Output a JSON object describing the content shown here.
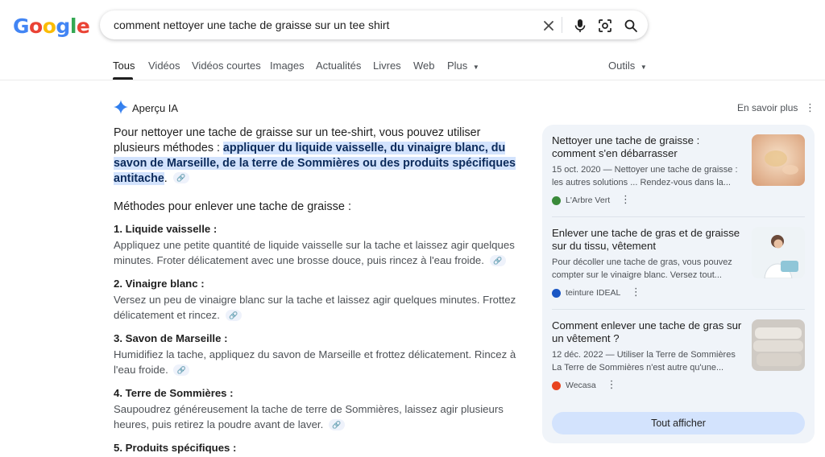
{
  "logo": {
    "letters": [
      "G",
      "o",
      "o",
      "g",
      "l",
      "e"
    ]
  },
  "search": {
    "query": "comment nettoyer une tache de graisse sur un tee shirt"
  },
  "search_icons": [
    "close-icon",
    "mic-icon",
    "lens-icon",
    "search-icon"
  ],
  "tabs": [
    {
      "label": "Tous",
      "active": true
    },
    {
      "label": "Vidéos"
    },
    {
      "label": "Vidéos courtes"
    },
    {
      "label": "Images"
    },
    {
      "label": "Actualités"
    },
    {
      "label": "Livres"
    },
    {
      "label": "Web"
    },
    {
      "label": "Plus"
    }
  ],
  "tools_label": "Outils",
  "ai": {
    "title": "Aperçu IA",
    "learn_more": "En savoir plus",
    "intro_plain": "Pour nettoyer une tache de graisse sur un tee-shirt, vous pouvez utiliser plusieurs méthodes : ",
    "intro_highlight": "appliquer du liquide vaisselle, du vinaigre blanc, du savon de Marseille, de la terre de Sommières ou des produits spécifiques antitache",
    "intro_end": ".",
    "methods_heading": "Méthodes pour enlever une tache de graisse :",
    "methods": [
      {
        "title": "1. Liquide vaisselle :",
        "text": "Appliquez une petite quantité de liquide vaisselle sur la tache et laissez agir quelques minutes. Froter délicatement avec une brosse douce, puis rincez à l'eau froide."
      },
      {
        "title": "2. Vinaigre blanc :",
        "text": "Versez un peu de vinaigre blanc sur la tache et laissez agir quelques minutes. Frottez délicatement et rincez."
      },
      {
        "title": "3. Savon de Marseille :",
        "text": "Humidifiez la tache, appliquez du savon de Marseille et frottez délicatement. Rincez à l'eau froide."
      },
      {
        "title": "4. Terre de Sommières :",
        "text": "Saupoudrez généreusement la tache de terre de Sommières, laissez agir plusieurs heures, puis retirez la poudre avant de laver."
      },
      {
        "title": "5. Produits spécifiques :",
        "text": ""
      }
    ]
  },
  "sources": [
    {
      "title": "Nettoyer une tache de graisse : comment s'en débarrasser",
      "snippet": "15 oct. 2020 — Nettoyer une tache de graisse : les autres solutions ... Rendez-vous dans la...",
      "site": "L'Arbre Vert",
      "favicon_color": "#3a8a3a"
    },
    {
      "title": "Enlever une tache de gras et de graisse sur du tissu, vêtement",
      "snippet": "Pour décoller une tache de gras, vous pouvez compter sur le vinaigre blanc. Versez tout...",
      "site": "teinture IDEAL",
      "favicon_color": "#1a56c4"
    },
    {
      "title": "Comment enlever une tache de gras sur un vêtement ?",
      "snippet": "12 déc. 2022 — Utiliser la Terre de Sommières La Terre de Sommières n'est autre qu'une...",
      "site": "Wecasa",
      "favicon_color": "#e8431f"
    }
  ],
  "show_all": "Tout afficher",
  "colors": {
    "accent": "#1a73e8",
    "highlight": "#d3e3fd",
    "panel": "#f0f4f9"
  }
}
